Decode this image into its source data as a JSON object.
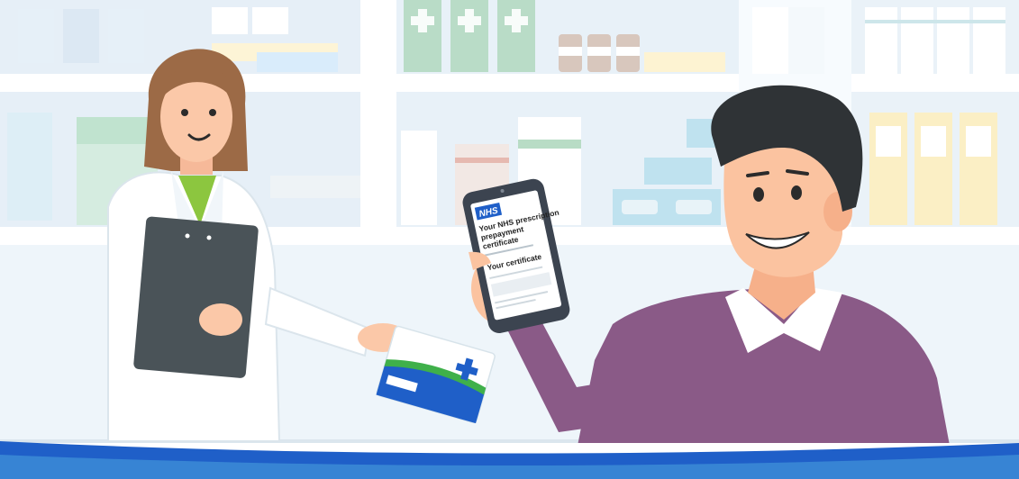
{
  "scene": "pharmacy",
  "phone": {
    "brand": "NHS",
    "heading_line1": "Your NHS prescription",
    "heading_line2": "prepayment",
    "heading_line3": "certificate",
    "subheading": "Your certificate"
  },
  "colors": {
    "nhs_blue": "#1f5fc8",
    "accent_green": "#3fb04a",
    "sweater": "#8a5a87",
    "hair": "#2f3336"
  }
}
